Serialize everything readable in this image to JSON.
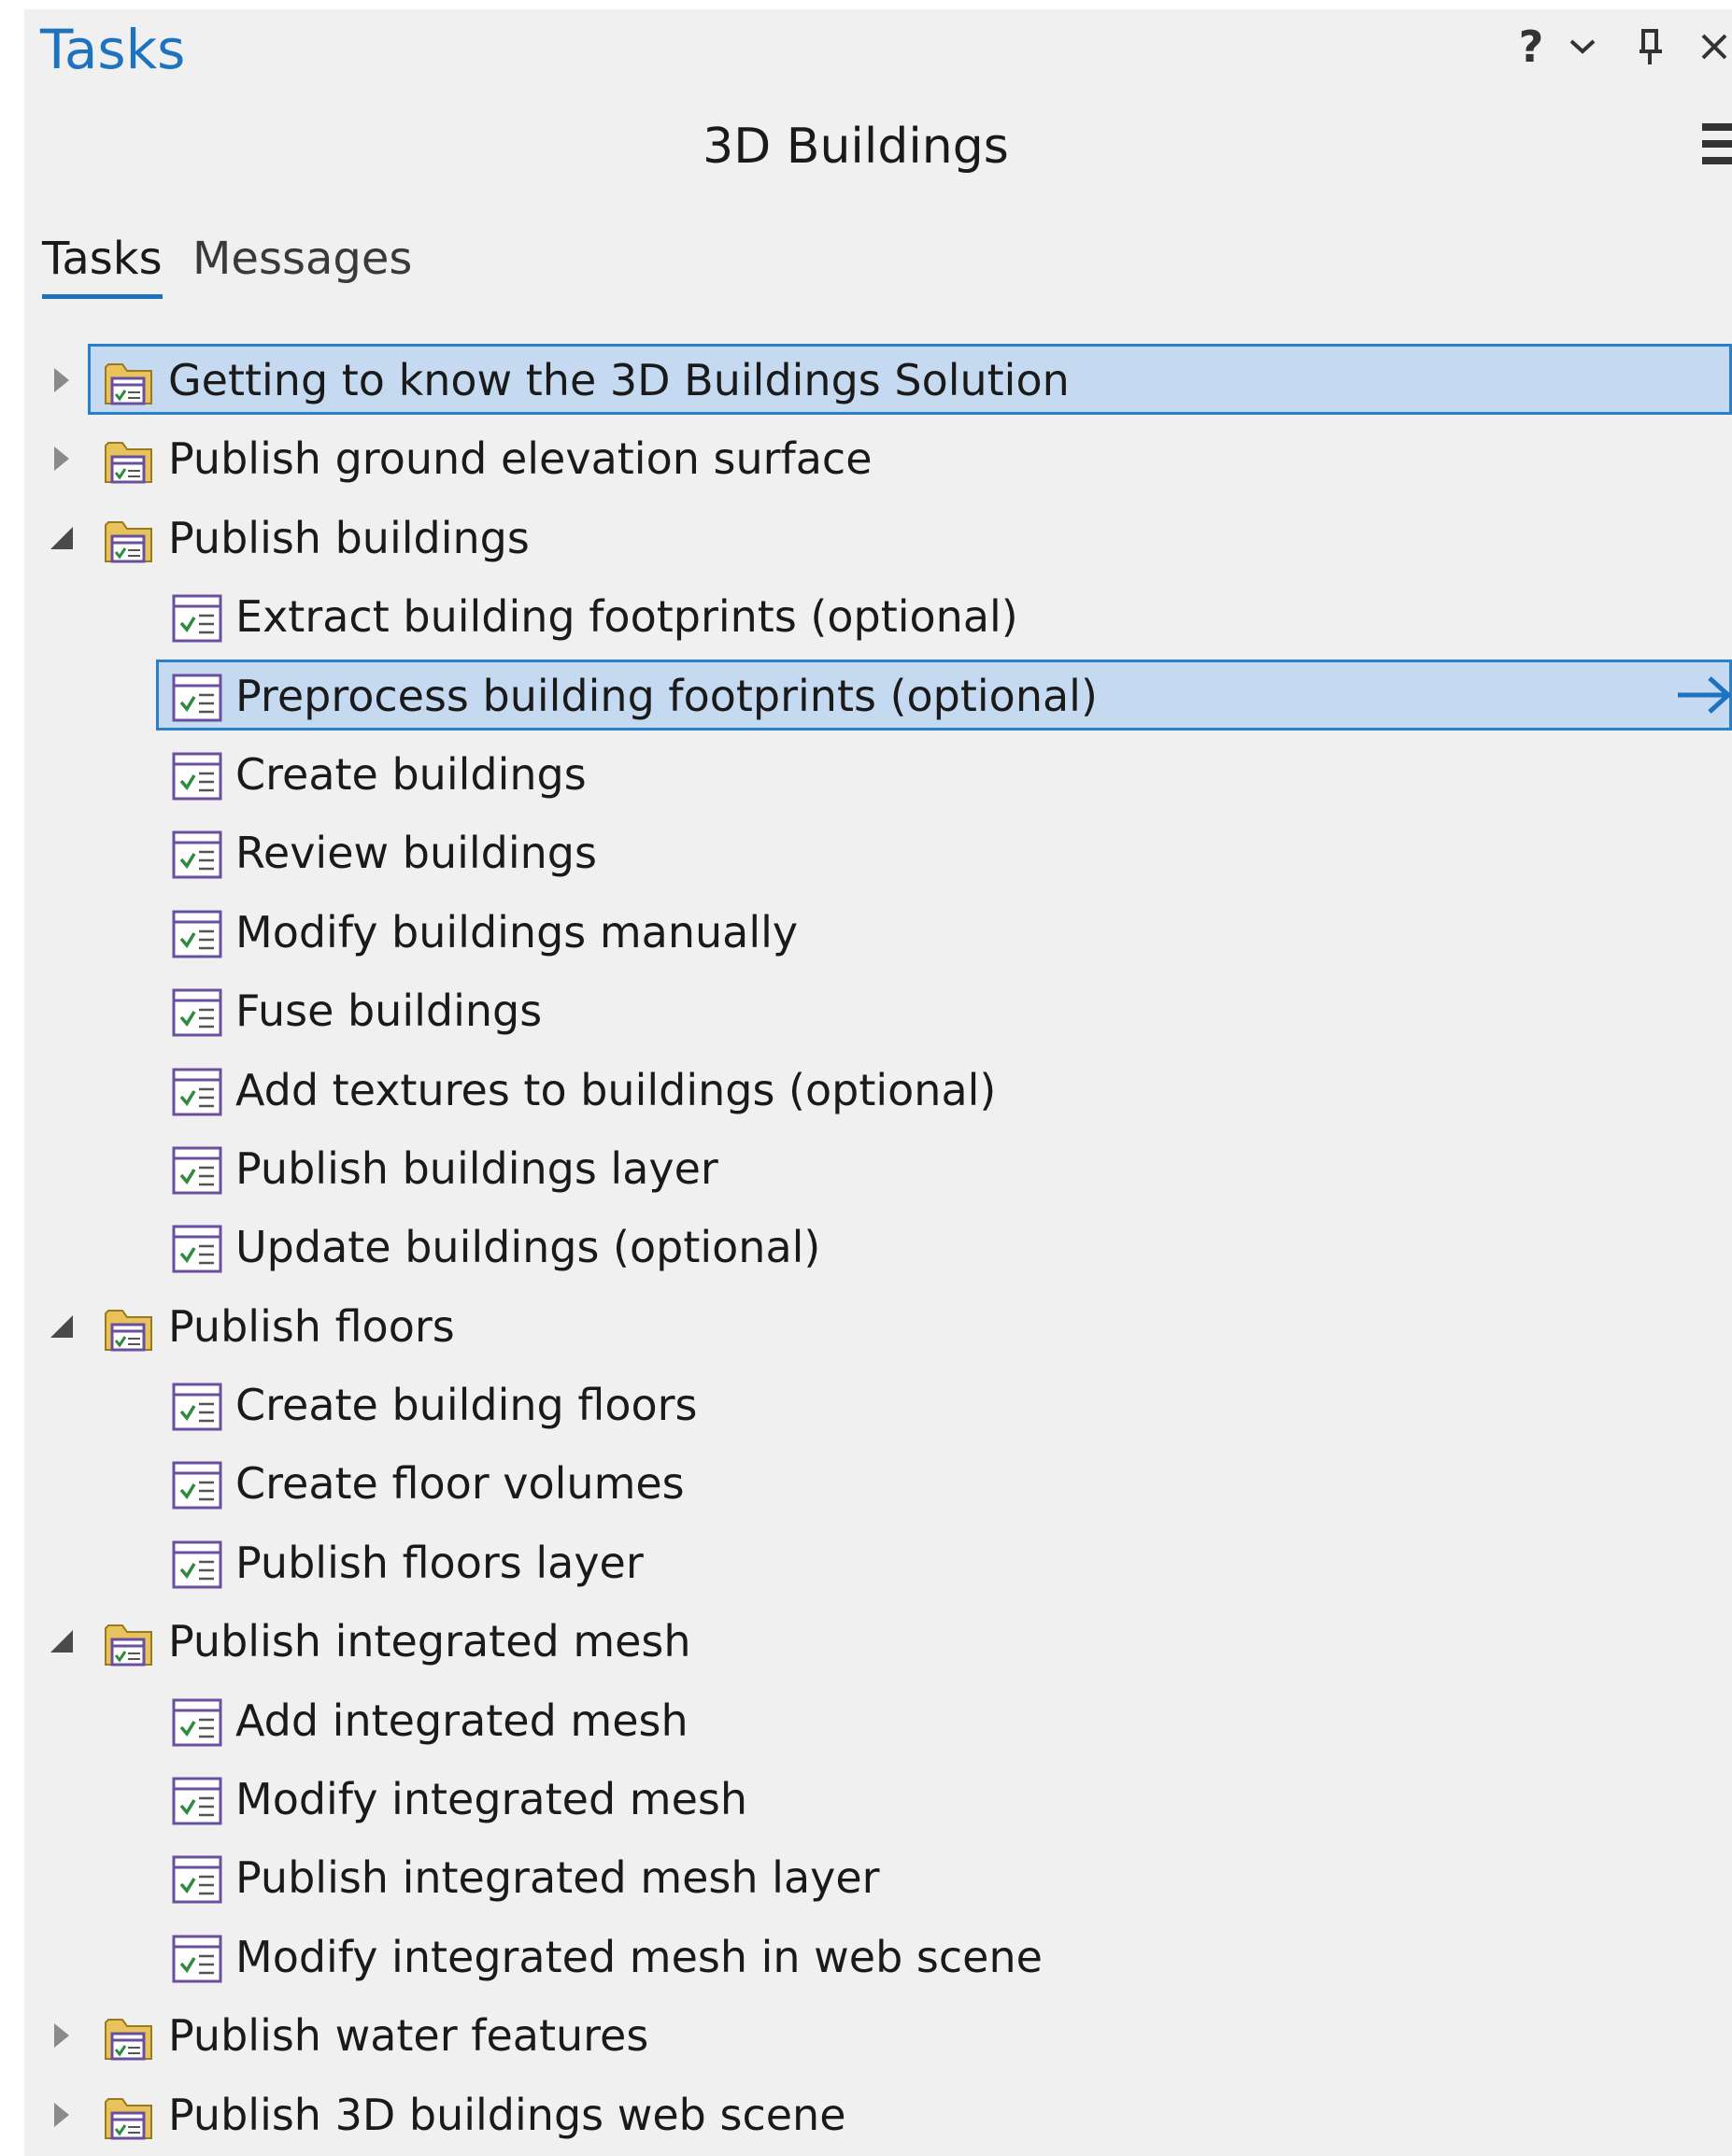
{
  "pane": {
    "title": "Tasks",
    "controls": {
      "help": "?",
      "options": "⌄",
      "close": "✕"
    }
  },
  "task_header": "3D Buildings",
  "tabs": [
    {
      "label": "Tasks",
      "active": true
    },
    {
      "label": "Messages",
      "active": false
    }
  ],
  "colors": {
    "accent": "#1e73be",
    "selection_fill": "#c5daf0",
    "selection_border": "#2a7fc9",
    "pane_background": "#f0f0f0",
    "icon_purple": "#6a4fa0",
    "folder_yellow": "#e8c25a"
  },
  "icons": {
    "group": "task-group-folder-icon",
    "task": "task-checklist-icon",
    "run": "run-task-arrow-icon"
  },
  "tree": [
    {
      "label": "Getting to know the 3D Buildings Solution",
      "type": "group",
      "expanded": false,
      "selected": true
    },
    {
      "label": "Publish ground elevation surface",
      "type": "group",
      "expanded": false
    },
    {
      "label": "Publish buildings",
      "type": "group",
      "expanded": true
    },
    {
      "label": "Extract building footprints (optional)",
      "type": "task"
    },
    {
      "label": "Preprocess building footprints (optional)",
      "type": "task",
      "selected": true
    },
    {
      "label": "Create buildings",
      "type": "task"
    },
    {
      "label": "Review buildings",
      "type": "task"
    },
    {
      "label": "Modify buildings manually",
      "type": "task"
    },
    {
      "label": "Fuse buildings",
      "type": "task"
    },
    {
      "label": "Add textures to buildings (optional)",
      "type": "task"
    },
    {
      "label": "Publish buildings layer",
      "type": "task"
    },
    {
      "label": "Update buildings (optional)",
      "type": "task"
    },
    {
      "label": "Publish floors",
      "type": "group",
      "expanded": true
    },
    {
      "label": "Create building floors",
      "type": "task"
    },
    {
      "label": "Create floor volumes",
      "type": "task"
    },
    {
      "label": "Publish floors layer",
      "type": "task"
    },
    {
      "label": "Publish integrated mesh",
      "type": "group",
      "expanded": true
    },
    {
      "label": "Add integrated mesh",
      "type": "task"
    },
    {
      "label": "Modify integrated mesh",
      "type": "task"
    },
    {
      "label": "Publish integrated mesh layer",
      "type": "task"
    },
    {
      "label": "Modify integrated mesh in web scene",
      "type": "task"
    },
    {
      "label": "Publish water features",
      "type": "group",
      "expanded": false
    },
    {
      "label": "Publish 3D buildings web scene",
      "type": "group",
      "expanded": false
    }
  ]
}
